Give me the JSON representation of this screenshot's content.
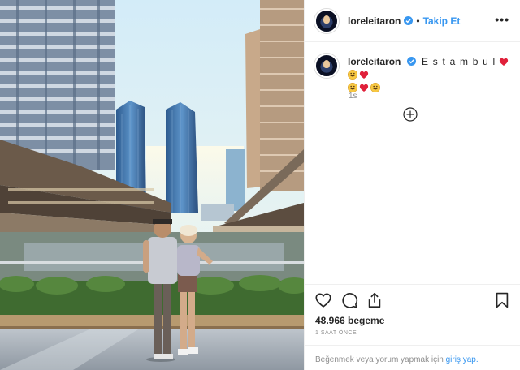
{
  "post": {
    "username": "loreleitaron",
    "follow_label": "Takip Et",
    "separator": "•",
    "more_label": "•••",
    "caption": "E s t a m b u l",
    "caption_emojis": [
      "red-heart",
      "grinning-face",
      "red-heart",
      "grinning-face",
      "red-heart",
      "grinning-face"
    ],
    "time": "1s",
    "likes": "48.966 begeme",
    "ago": "1 SAAT ÖNCE",
    "login_prompt": "Beğenmek veya yorum yapmak için ",
    "login_link": "giriş yap."
  },
  "icons": {
    "verified": "verified-badge-icon",
    "load_more": "plus-circle-icon",
    "like": "heart-outline-icon",
    "comment": "speech-bubble-icon",
    "share": "share-upload-icon",
    "save": "bookmark-icon"
  },
  "colors": {
    "accent": "#3897f0",
    "text": "#262626",
    "muted": "#8e8e8e",
    "border": "#efefef",
    "heart": "#ed4956",
    "emoji_yellow": "#f7c843"
  }
}
